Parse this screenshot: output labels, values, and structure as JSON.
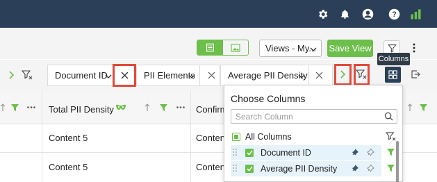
{
  "topbar": {
    "icons": [
      "gear-icon",
      "bell-icon",
      "user-icon",
      "help-icon",
      "analytics-icon"
    ],
    "colors": {
      "bg": "#2b4058",
      "analytics": "#6cbf4a"
    }
  },
  "toolbar": {
    "view_toggle": [
      "list-view-icon",
      "image-view-icon"
    ],
    "views_dropdown": "Views - My...",
    "save_view": "Save View",
    "tooltip": "Columns"
  },
  "filter_chips": [
    {
      "label": "Document ID"
    },
    {
      "label": "PII Elements"
    },
    {
      "label": "Average PII Density"
    }
  ],
  "grid": {
    "headers": [
      "Total PII Density",
      "Confirm"
    ],
    "rows": [
      [
        "Content 5",
        "Content"
      ],
      [
        "Content 5",
        "Content"
      ]
    ]
  },
  "column_panel": {
    "title": "Choose Columns",
    "search_placeholder": "Search Column",
    "all_columns_label": "All Columns",
    "items": [
      {
        "label": "Document ID",
        "checked": true
      },
      {
        "label": "Average PII Density",
        "checked": true
      }
    ]
  },
  "colors": {
    "accent_green": "#6cbf4a",
    "highlight_red": "#e24a3a",
    "nav_dark": "#2b4058",
    "selected_row": "#e6f3fb"
  }
}
